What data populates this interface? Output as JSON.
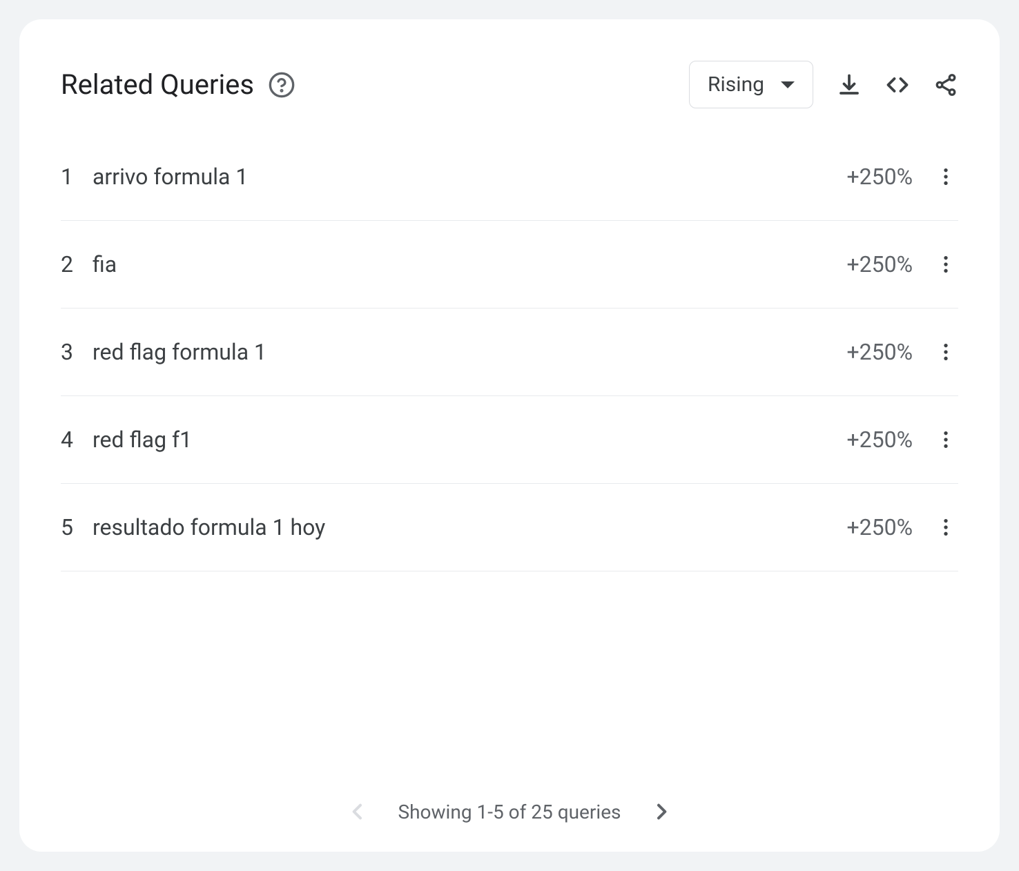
{
  "header": {
    "title": "Related Queries",
    "dropdown_label": "Rising"
  },
  "rows": [
    {
      "rank": "1",
      "query": "arrivo formula 1",
      "value": "+250%"
    },
    {
      "rank": "2",
      "query": "fia",
      "value": "+250%"
    },
    {
      "rank": "3",
      "query": "red flag formula 1",
      "value": "+250%"
    },
    {
      "rank": "4",
      "query": "red flag f1",
      "value": "+250%"
    },
    {
      "rank": "5",
      "query": "resultado formula 1 hoy",
      "value": "+250%"
    }
  ],
  "footer": {
    "pagination_text": "Showing 1-5 of 25 queries"
  }
}
